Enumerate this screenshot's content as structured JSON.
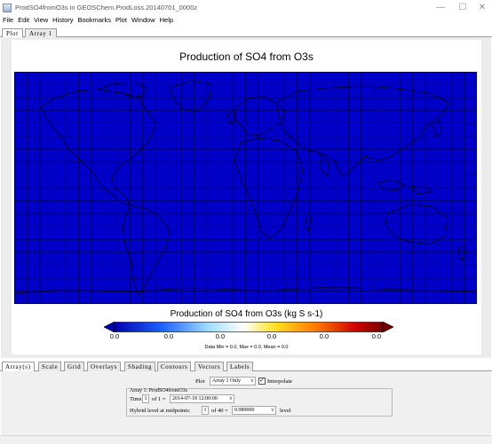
{
  "window": {
    "title": "ProdSO4fromO3s in GEOSChem.ProdLoss.20140701_0000z",
    "minimize_glyph": "—",
    "maximize_glyph": "☐",
    "close_glyph": "✕"
  },
  "menu": [
    "File",
    "Edit",
    "View",
    "History",
    "Bookmarks",
    "Plot",
    "Window",
    "Help"
  ],
  "top_tabs": [
    {
      "label": "Plot",
      "active": true
    },
    {
      "label": "Array 1",
      "active": false
    }
  ],
  "plot": {
    "title": "Production of SO4 from O3s",
    "map_fill": "#0000c8",
    "colorbar_title": "Production of SO4 from O3s (kg S s-1)",
    "colorbar_ticks": [
      "0.0",
      "0.0",
      "0.0",
      "0.0",
      "0.0",
      "0.0"
    ],
    "stats": "Data Min = 0.0, Max = 0.0, Mean = 0.0"
  },
  "bottom_tabs": [
    {
      "label": "Array(s)",
      "active": true
    },
    {
      "label": "Scale",
      "active": false
    },
    {
      "label": "Grid",
      "active": false
    },
    {
      "label": "Overlays",
      "active": false
    },
    {
      "label": "Shading",
      "active": false
    },
    {
      "label": "Contours",
      "active": false
    },
    {
      "label": "Vectors",
      "active": false
    },
    {
      "label": "Labels",
      "active": false
    }
  ],
  "settings": {
    "plot_label": "Plot",
    "plot_mode": "Array 1 Only",
    "interpolate_label": "Interpolate",
    "interpolate_checked": true,
    "array_group_title": "Array 1: ProdSO4fromO3s",
    "time_label": "Time:",
    "time_index": "1",
    "time_of": "of 1 =",
    "time_value": "2014-07-18 12:00:00",
    "level_label": "Hybrid level at midpoints:",
    "level_index": "1",
    "level_of": "of 40 =",
    "level_value": "0.989000",
    "level_unit": "level"
  }
}
